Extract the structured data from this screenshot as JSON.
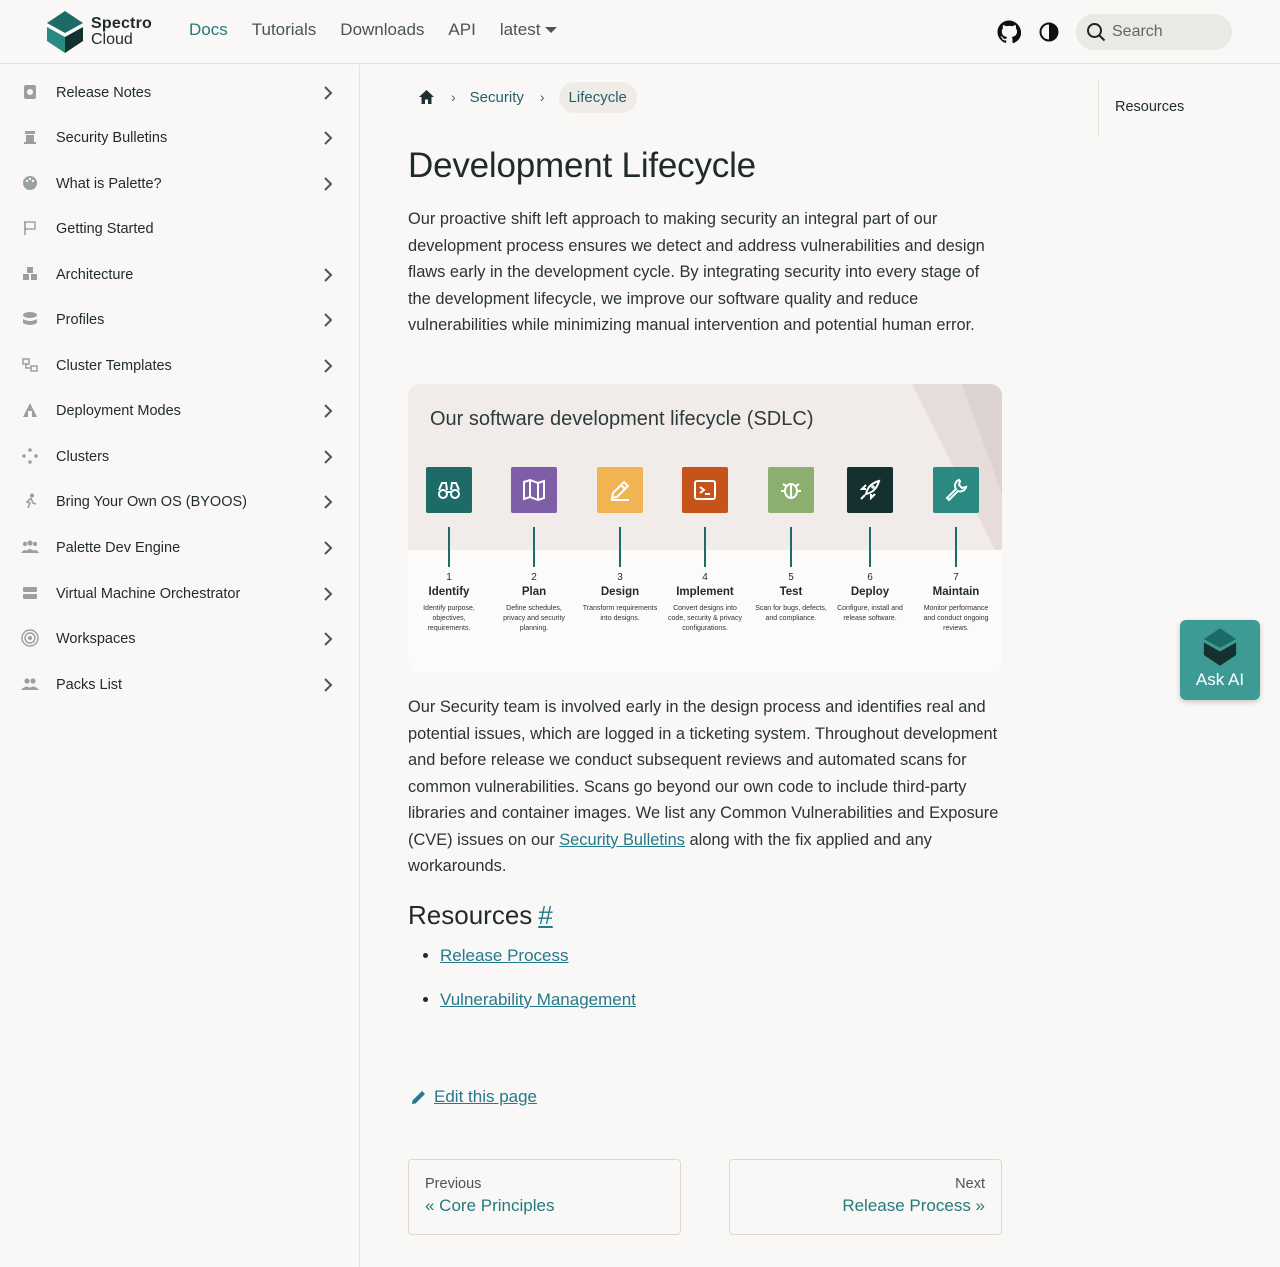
{
  "brand": {
    "line1": "Spectro",
    "line2": "Cloud"
  },
  "nav": {
    "links": [
      "Docs",
      "Tutorials",
      "Downloads",
      "API"
    ],
    "version": "latest",
    "search_placeholder": "Search"
  },
  "sidebar": {
    "items": [
      {
        "label": "Release Notes",
        "icon": "release-notes-icon",
        "expandable": true
      },
      {
        "label": "Security Bulletins",
        "icon": "security-bulletins-icon",
        "expandable": true
      },
      {
        "label": "What is Palette?",
        "icon": "palette-icon",
        "expandable": true
      },
      {
        "label": "Getting Started",
        "icon": "flag-icon",
        "expandable": false
      },
      {
        "label": "Architecture",
        "icon": "cubes-icon",
        "expandable": true
      },
      {
        "label": "Profiles",
        "icon": "layers-icon",
        "expandable": true
      },
      {
        "label": "Cluster Templates",
        "icon": "template-icon",
        "expandable": true
      },
      {
        "label": "Deployment Modes",
        "icon": "deployment-icon",
        "expandable": true
      },
      {
        "label": "Clusters",
        "icon": "clusters-icon",
        "expandable": true
      },
      {
        "label": "Bring Your Own OS (BYOOS)",
        "icon": "byoos-icon",
        "expandable": true
      },
      {
        "label": "Palette Dev Engine",
        "icon": "users-icon",
        "expandable": true
      },
      {
        "label": "Virtual Machine Orchestrator",
        "icon": "server-icon",
        "expandable": true
      },
      {
        "label": "Workspaces",
        "icon": "workspaces-icon",
        "expandable": true
      },
      {
        "label": "Packs List",
        "icon": "packs-icon",
        "expandable": true
      }
    ]
  },
  "breadcrumb": {
    "items": [
      "Security",
      "Lifecycle"
    ]
  },
  "page": {
    "title": "Development Lifecycle",
    "intro": "Our proactive shift left approach to making security an integral part of our development process ensures we detect and address vulnerabilities and design flaws early in the development cycle. By integrating security into every stage of the development lifecycle, we improve our software quality and reduce vulnerabilities while minimizing manual intervention and potential human error.",
    "para2_before": "Our Security team is involved early in the design process and identifies real and potential issues, which are logged in a ticketing system. Throughout development and before release we conduct subsequent reviews and automated scans for common vulnerabilities. Scans go beyond our own code to include third-party libraries and container images. We list any Common Vulnerabilities and Exposure (CVE) issues on our ",
    "para2_link": "Security Bulletins",
    "para2_after": " along with the fix applied and any workarounds.",
    "resources_heading": "Resources",
    "resources_hash": "#",
    "resources": [
      "Release Process",
      "Vulnerability Management"
    ],
    "edit_label": "Edit this page"
  },
  "figure": {
    "title": "Our software development lifecycle (SDLC)",
    "stages": [
      {
        "num": "1",
        "name": "Identify",
        "desc": "Identify purpose, objectives, requirements.",
        "color": "#1d6b66",
        "icon": "binoculars-icon"
      },
      {
        "num": "2",
        "name": "Plan",
        "desc": "Define schedules, privacy and security planning.",
        "color": "#7f5ea8",
        "icon": "map-icon"
      },
      {
        "num": "3",
        "name": "Design",
        "desc": "Transform requirements into designs.",
        "color": "#f0b453",
        "icon": "pencil-icon"
      },
      {
        "num": "4",
        "name": "Implement",
        "desc": "Convert designs into code, security & privacy configurations.",
        "color": "#c5531a",
        "icon": "terminal-icon"
      },
      {
        "num": "5",
        "name": "Test",
        "desc": "Scan for bugs, defects, and compliance.",
        "color": "#8cae6f",
        "icon": "bug-icon"
      },
      {
        "num": "6",
        "name": "Deploy",
        "desc": "Configure, install and release software.",
        "color": "#14312f",
        "icon": "rocket-icon"
      },
      {
        "num": "7",
        "name": "Maintain",
        "desc": "Monitor performance and conduct ongoing reviews.",
        "color": "#2a8a82",
        "icon": "wrench-icon"
      }
    ]
  },
  "pager": {
    "prev_sub": "Previous",
    "prev_main": "« Core Principles",
    "next_sub": "Next",
    "next_main": "Release Process »"
  },
  "toc": {
    "items": [
      "Resources"
    ]
  },
  "ask_ai": {
    "label": "Ask AI"
  }
}
